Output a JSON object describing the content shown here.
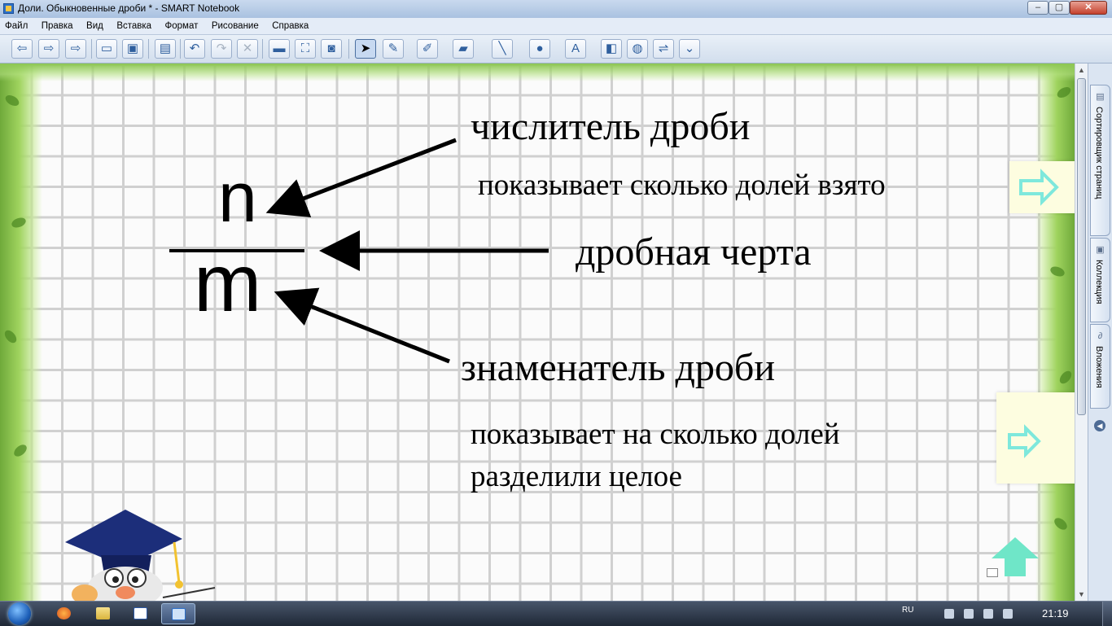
{
  "window": {
    "title": "Доли. Обыкновенные дроби * - SMART Notebook",
    "minimize": "–",
    "maximize": "▢",
    "close": "✕"
  },
  "menu": [
    "Файл",
    "Правка",
    "Вид",
    "Вставка",
    "Формат",
    "Рисование",
    "Справка"
  ],
  "toolbar": {
    "icons": [
      "prev-page-icon",
      "next-page-icon",
      "add-page-icon",
      "open-icon",
      "save-icon",
      "paste-icon",
      "undo-icon",
      "redo-icon",
      "delete-icon",
      "screen-shade-icon",
      "full-screen-icon",
      "capture-icon",
      "select-icon",
      "pen-icon",
      "creative-pen-icon",
      "eraser-icon",
      "line-icon",
      "shape-icon",
      "text-icon",
      "fill-icon",
      "properties-icon",
      "move-toolbar-icon",
      "more-icon"
    ]
  },
  "slide": {
    "numerator_var": "n",
    "denominator_var": "m",
    "numerator_title": "числитель дроби",
    "numerator_desc": "показывает сколько долей взято",
    "bar_title": "дробная черта",
    "denominator_title": "знаменатель дроби",
    "denominator_desc_line1": "показывает на сколько долей",
    "denominator_desc_line2": "разделили целое"
  },
  "side_tabs": {
    "page_sorter": "Сортировщик страниц",
    "gallery": "Коллекция",
    "attachments": "Вложения"
  },
  "taskbar": {
    "language": "RU",
    "clock": "21:19"
  },
  "colors": {
    "nav_arrow": "#7ee8dc",
    "home_arrow": "#6fe6c8",
    "border_green": "#8cc653"
  }
}
